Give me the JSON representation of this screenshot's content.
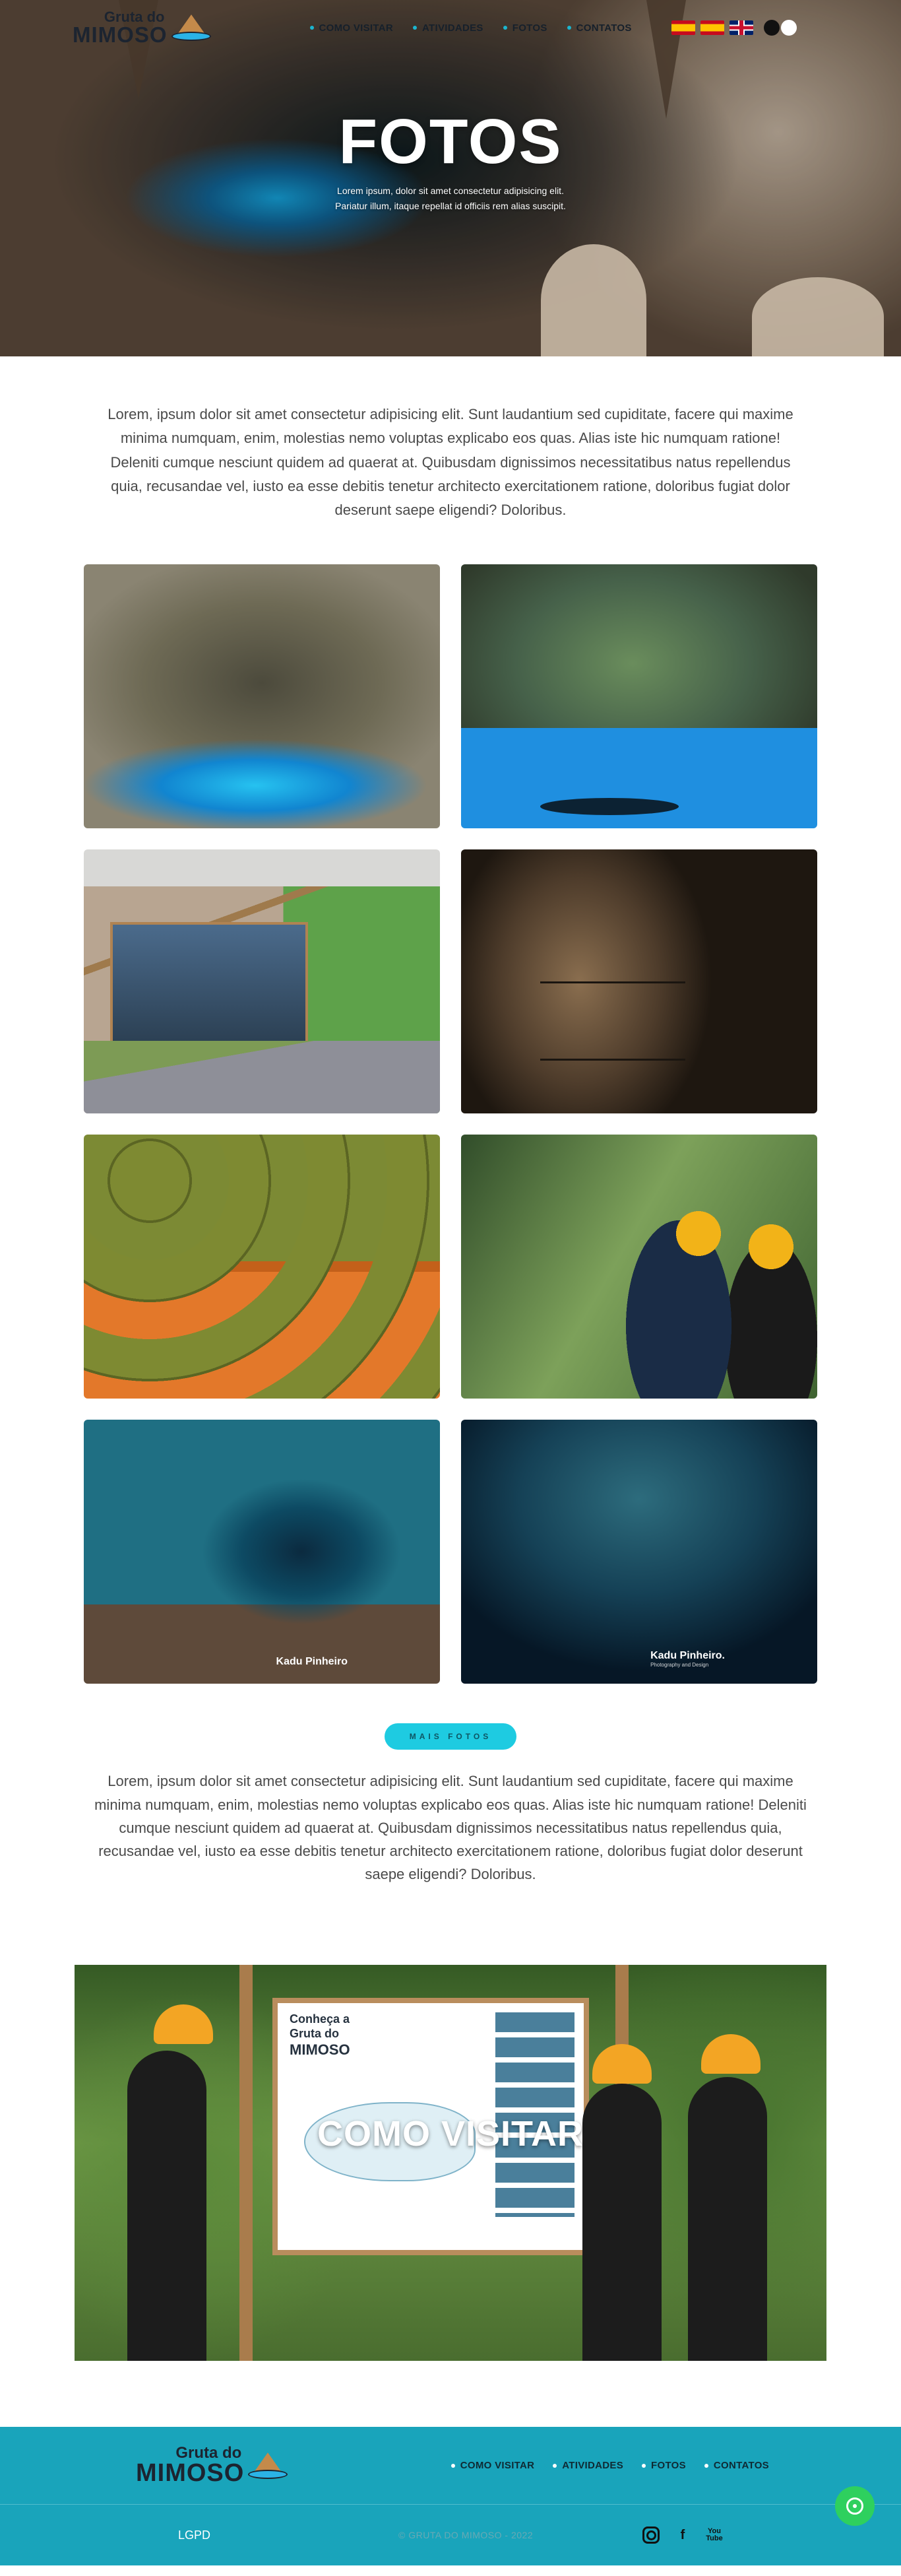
{
  "header": {
    "logo": {
      "line1": "Gruta do",
      "line2": "MIMOSO"
    },
    "nav": [
      {
        "label": "COMO VISITAR"
      },
      {
        "label": "ATIVIDADES"
      },
      {
        "label": "FOTOS"
      },
      {
        "label": "CONTATOS"
      }
    ],
    "languages": [
      "es-flag-icon",
      "es-flag-icon",
      "uk-flag-icon"
    ],
    "theme_toggle": [
      "dark",
      "light"
    ]
  },
  "hero": {
    "title": "FOTOS",
    "subtitle": "Lorem ipsum, dolor sit amet consectetur adipisicing elit. Pariatur illum, itaque repellat id officiis rem alias suscipit."
  },
  "intro": {
    "text": "Lorem, ipsum dolor sit amet consectetur adipisicing elit. Sunt laudantium sed cupiditate, facere qui maxime minima numquam, enim, molestias nemo voluptas explicabo eos quas. Alias iste hic numquam ratione! Deleniti cumque nesciunt quidem ad quaerat at. Quibusdam dignissimos necessitatibus natus repellendus quia, recusandae vel, iusto ea esse debitis tenetur architecto exercitationem ratione, doloribus fugiat dolor deserunt saepe eligendi? Doloribus."
  },
  "gallery": {
    "photos": [
      {
        "name": "cave-lake-photo"
      },
      {
        "name": "kayak-cave-photo"
      },
      {
        "name": "visitor-center-photo"
      },
      {
        "name": "cave-walkway-photo"
      },
      {
        "name": "helmets-shelf-photo"
      },
      {
        "name": "guided-trail-photo"
      },
      {
        "name": "diver-cave-photo",
        "watermark": "Kadu Pinheiro"
      },
      {
        "name": "diver-blue-cave-photo",
        "watermark": "Kadu Pinheiro.",
        "watermark_sub": "Photography and Design"
      }
    ]
  },
  "more": {
    "label": "MAIS FOTOS"
  },
  "outro": {
    "text": "Lorem, ipsum dolor sit amet consectetur adipisicing elit. Sunt laudantium sed cupiditate, facere qui maxime minima numquam, enim, molestias nemo voluptas explicabo eos quas. Alias iste hic numquam ratione! Deleniti cumque nesciunt quidem ad quaerat at. Quibusdam dignissimos necessitatibus natus repellendus quia, recusandae vel, iusto ea esse debitis tenetur architecto exercitationem ratione, doloribus fugiat dolor deserunt saepe eligendi? Doloribus."
  },
  "cta": {
    "title": "COMO VISITAR",
    "board_heading_line1": "Conheça a",
    "board_heading_line2": "Gruta do",
    "board_heading_line3": "MIMOSO"
  },
  "footer": {
    "logo": {
      "line1": "Gruta do",
      "line2": "MIMOSO"
    },
    "nav": [
      {
        "label": "COMO VISITAR"
      },
      {
        "label": "ATIVIDADES"
      },
      {
        "label": "FOTOS"
      },
      {
        "label": "CONTATOS"
      }
    ],
    "lgpd": "LGPD",
    "copyright": "© GRUTA DO MIMOSO - 2022",
    "socials": [
      "instagram-icon",
      "facebook-icon",
      "youtube-icon"
    ]
  },
  "colors": {
    "accent": "#1ecbe1",
    "footer_bg": "#19a4bb",
    "nav_dot": "#1bb5cf",
    "whatsapp": "#2ed05e"
  }
}
